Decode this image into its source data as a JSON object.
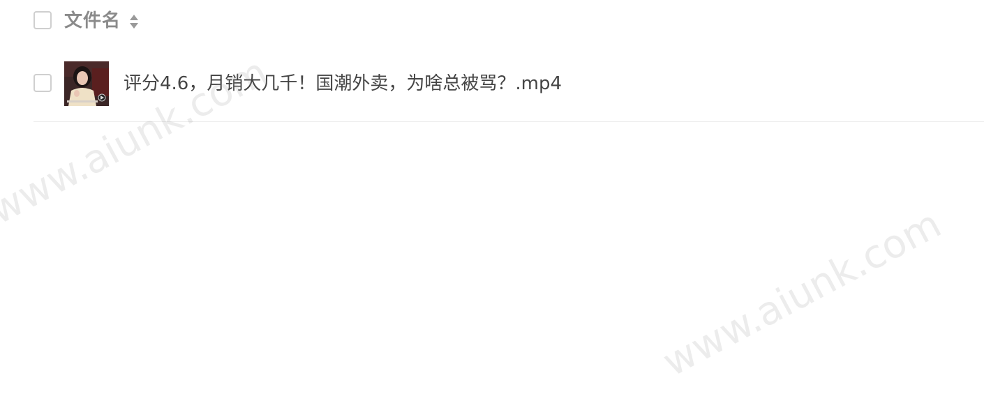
{
  "table": {
    "header": {
      "column_label": "文件名",
      "sort_icon": "sort-up-down-icon"
    },
    "rows": [
      {
        "name": "评分4.6，月销大几千！国潮外卖，为啥总被骂？.mp4",
        "thumbnail": "video-thumbnail"
      }
    ]
  },
  "watermark": {
    "text": "www.aiunk.com"
  }
}
